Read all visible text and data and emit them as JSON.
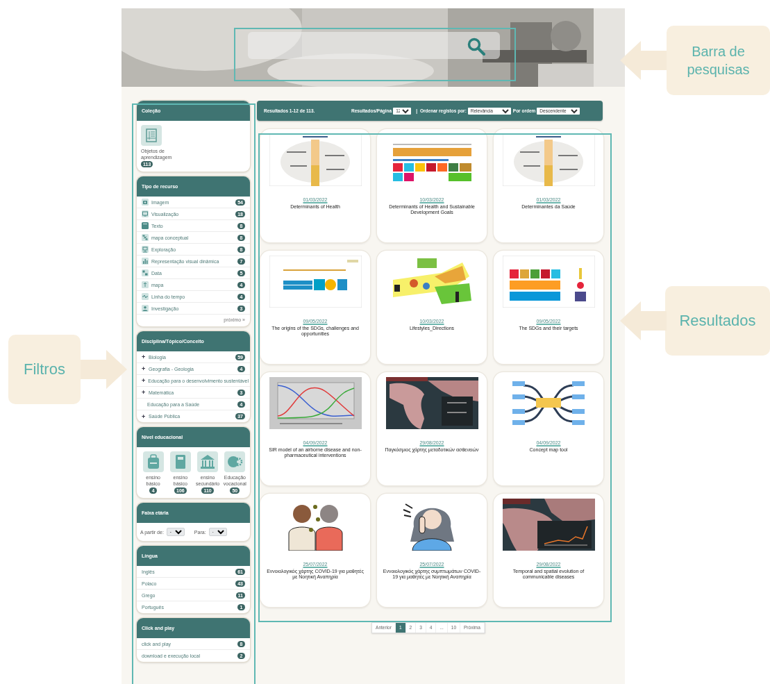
{
  "sidebar": [
    {
      "kind": "tiles",
      "title": "Coleção",
      "items": [
        {
          "label": "Objetos de aprendizagem",
          "count": "113"
        }
      ]
    },
    {
      "kind": "list",
      "title": "Tipo de recurso",
      "items": [
        {
          "label": "Imagem",
          "count": "54"
        },
        {
          "label": "Visualização",
          "count": "18"
        },
        {
          "label": "Texto",
          "count": "8"
        },
        {
          "label": "mapa conceptual",
          "count": "8"
        },
        {
          "label": "Exploração",
          "count": "8"
        },
        {
          "label": "Representação visual dinâmica",
          "count": "7"
        },
        {
          "label": "Data",
          "count": "5"
        },
        {
          "label": "mapa",
          "count": "4"
        },
        {
          "label": "Linha do tempo",
          "count": "4"
        },
        {
          "label": "Investigação",
          "count": "3"
        }
      ],
      "more": "próximo »"
    },
    {
      "kind": "tree",
      "title": "Disciplina/Tópico/Conceito",
      "items": [
        {
          "expander": "+",
          "label": "Biologia",
          "count": "59"
        },
        {
          "expander": "+",
          "label": "Geografia - Geologia",
          "count": "4"
        },
        {
          "expander": "+",
          "label": "Educação para o desenvolvimento sustentável"
        },
        {
          "expander": "+",
          "label": "Matemática",
          "count": "3"
        },
        {
          "label": "Educação para a Saúde",
          "count": "4"
        },
        {
          "expander": "+",
          "label": "Saúde Pública",
          "count": "37"
        }
      ]
    },
    {
      "kind": "tiles",
      "title": "Nível educacional",
      "items": [
        {
          "label": "ensino básico",
          "count": "4"
        },
        {
          "label": "ensino básico",
          "count": "106"
        },
        {
          "label": "ensino secundário",
          "count": "110"
        },
        {
          "label": "Educação vocacional",
          "count": "50"
        }
      ]
    },
    {
      "kind": "range",
      "title": "Faixa etária",
      "fields": [
        {
          "label": "A partir de:",
          "value": "-"
        },
        {
          "label": "Para:",
          "value": "-"
        }
      ]
    },
    {
      "kind": "list",
      "title": "Língua",
      "items": [
        {
          "label": "Inglês",
          "count": "61"
        },
        {
          "label": "Polaco",
          "count": "43"
        },
        {
          "label": "Grego",
          "count": "11"
        },
        {
          "label": "Português",
          "count": "1"
        }
      ]
    },
    {
      "kind": "list",
      "title": "Click and play",
      "items": [
        {
          "label": "click and play",
          "count": "8"
        },
        {
          "label": "download e execução local",
          "count": "2"
        }
      ]
    }
  ],
  "results_bar": {
    "summary": "Resultados 1-12 de 113.",
    "per_page_label": "Resultados/Página",
    "per_page": "12",
    "separator": "|",
    "sort_label": "Ordenar registos por:",
    "sort": "Relevância",
    "order_label": "Por ordem",
    "order": "Descendente"
  },
  "results": [
    {
      "date": "01/03/2022",
      "title": "Determinants of Health"
    },
    {
      "date": "10/03/2022",
      "title": "Determinants of Health and Sustainable Development Goals"
    },
    {
      "date": "01/03/2022",
      "title": "Determinantes da Saúde"
    },
    {
      "date": "09/05/2022",
      "title": "The origins of the SDGs, challenges and opportunities"
    },
    {
      "date": "10/03/2022",
      "title": "Lifestyles_Directions"
    },
    {
      "date": "09/05/2022",
      "title": "The SDGs and their targets"
    },
    {
      "date": "04/09/2022",
      "title": "SIR model of an airborne disease and non-pharmaceutical interventions"
    },
    {
      "date": "29/08/2022",
      "title": "Παγκόσμιος χάρτης μεταδοτικών ασθενειών"
    },
    {
      "date": "04/09/2022",
      "title": "Concept map tool"
    },
    {
      "date": "25/07/2022",
      "title": "Εννοιολογικός χάρτης COVID-19 για μαθητές με Νοητική Αναπηρία"
    },
    {
      "date": "25/07/2022",
      "title": "Εννοιολογικός χάρτης συμπτωμάτων COVID-19 για μαθητές με Νοητική Αναπηρία"
    },
    {
      "date": "29/08/2022",
      "title": "Temporal and spatial evolution of communicable diseases"
    }
  ],
  "pagination": [
    {
      "label": "Anterior",
      "selected": false
    },
    {
      "label": "1",
      "selected": true
    },
    {
      "label": "2",
      "selected": false
    },
    {
      "label": "3",
      "selected": false
    },
    {
      "label": "4",
      "selected": false
    },
    {
      "label": "...",
      "selected": false
    },
    {
      "label": "10",
      "selected": false
    },
    {
      "label": "Próxima",
      "selected": false
    }
  ],
  "annotations": [
    {
      "label": "Barra de pesquisas"
    },
    {
      "label": "Resultados"
    },
    {
      "label": "Filtros"
    }
  ]
}
